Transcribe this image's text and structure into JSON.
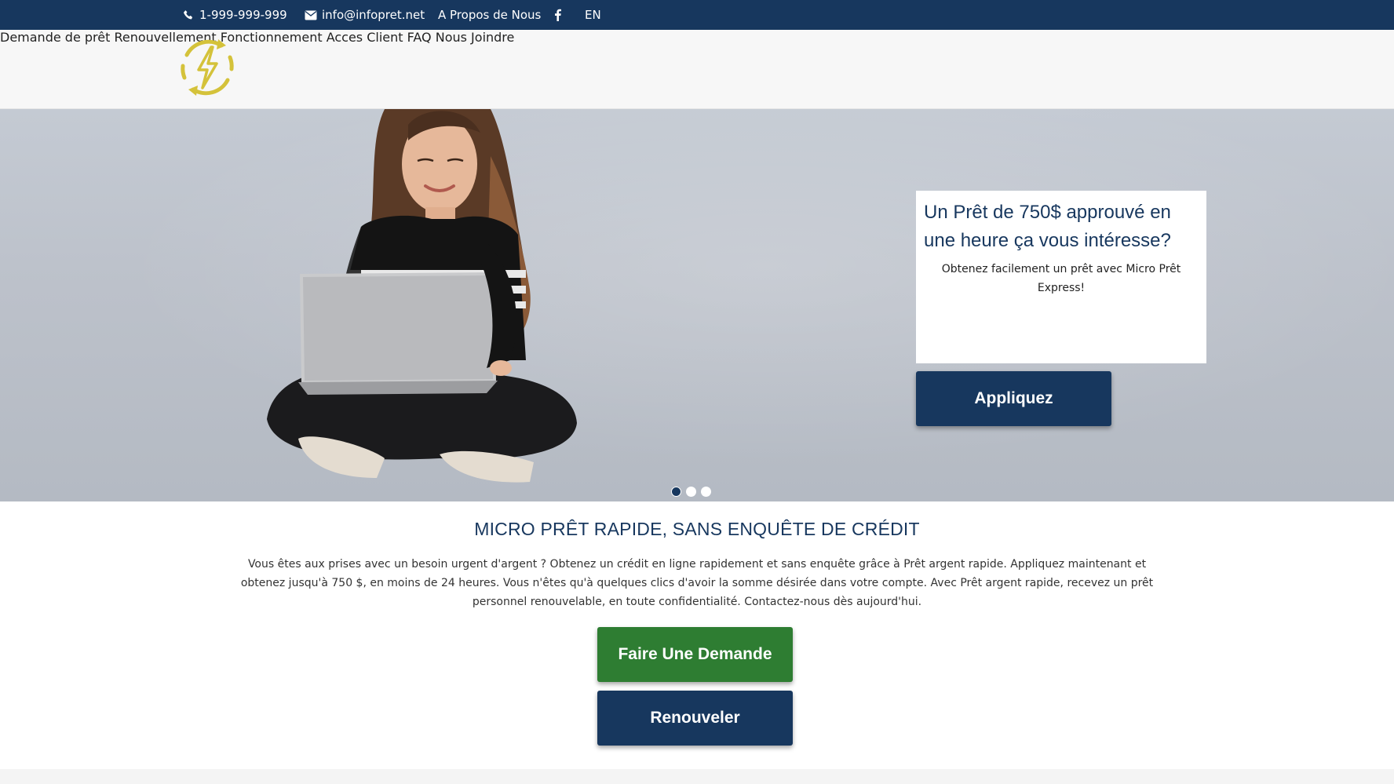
{
  "topbar": {
    "phone": "1-999-999-999",
    "email": "info@infopret.net",
    "about": "A Propos de Nous",
    "facebook_icon": "facebook-icon",
    "lang": "EN"
  },
  "header": {
    "logo_icon": "lightning-refresh-logo",
    "nav": [
      "Demande de prêt",
      "Renouvellement",
      "Fonctionnement",
      "Acces Client",
      "FAQ",
      "Nous Joindre"
    ]
  },
  "hero": {
    "promo_title": "Un Prêt de 750$ approuvé en une heure ça vous intéresse?",
    "promo_sub": "Obtenez facilement un prêt avec Micro Prêt Express!",
    "apply_label": "Appliquez",
    "slides": 3,
    "active_slide": 1
  },
  "intro": {
    "heading": "MICRO PRÊT RAPIDE, SANS ENQUÊTE DE CRÉDIT",
    "body": "Vous êtes aux prises avec un besoin urgent d'argent ? Obtenez un crédit en ligne rapidement et sans enquête grâce à Prêt argent rapide. Appliquez maintenant et obtenez jusqu'à 750 $, en moins de 24 heures. Vous n'êtes qu'à quelques clics d'avoir la somme désirée dans votre compte. Avec Prêt argent rapide, recevez un prêt personnel renouvelable, en toute confidentialité. Contactez-nous dès aujourd'hui.",
    "request_label": "Faire Une Demande",
    "renew_label": "Renouveler"
  },
  "colors": {
    "navy": "#17375e",
    "green": "#2e7d32",
    "logo_gold": "#d4c23a"
  }
}
